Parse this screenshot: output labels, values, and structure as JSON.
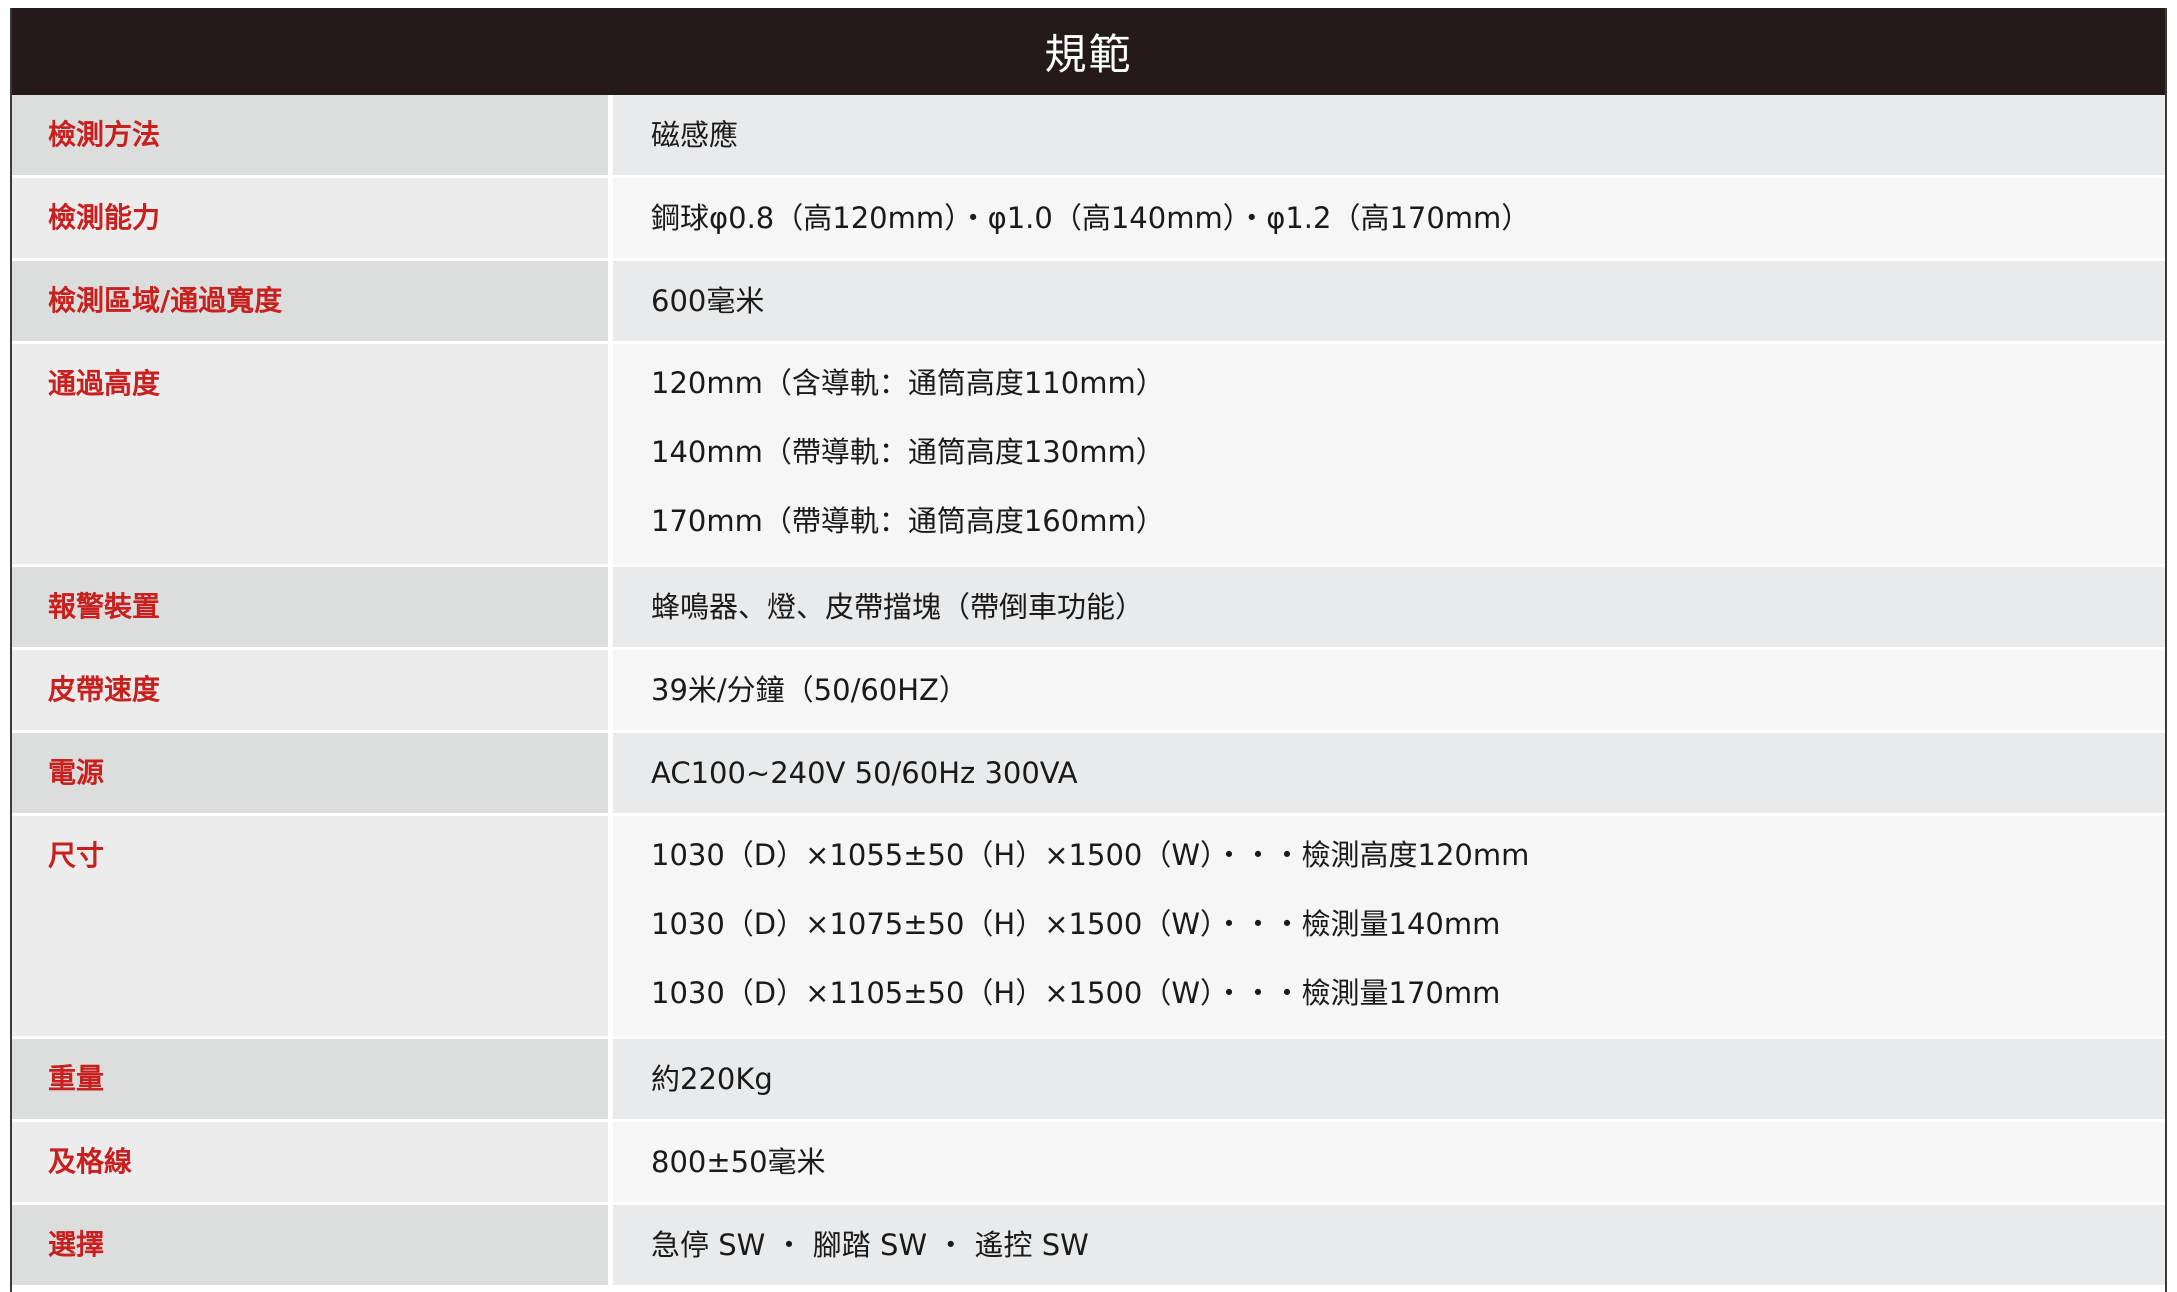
{
  "title": "規範",
  "rows": [
    {
      "label": "檢測方法",
      "values": [
        "磁感應"
      ]
    },
    {
      "label": "檢測能力",
      "values": [
        "鋼球φ0.8（高120mm）・φ1.0（高140mm）・φ1.2（高170mm）"
      ]
    },
    {
      "label": "檢測區域/通過寬度",
      "values": [
        "600毫米"
      ]
    },
    {
      "label": "通過高度",
      "values": [
        "120mm（含導軌：通筒高度110mm）",
        "140mm（帶導軌：通筒高度130mm）",
        "170mm（帶導軌：通筒高度160mm）"
      ]
    },
    {
      "label": "報警裝置",
      "values": [
        "蜂鳴器、燈、皮帶擋塊（帶倒車功能）"
      ]
    },
    {
      "label": "皮帶速度",
      "values": [
        "39米/分鐘（50/60HZ）"
      ]
    },
    {
      "label": "電源",
      "values": [
        "AC100~240V 50/60Hz 300VA"
      ]
    },
    {
      "label": "尺寸",
      "values": [
        "1030（D）×1055±50（H）×1500（W）・・・檢測高度120mm",
        "1030（D）×1075±50（H）×1500（W）・・・檢測量140mm",
        "1030（D）×1105±50（H）×1500（W）・・・檢測量170mm"
      ]
    },
    {
      "label": "重量",
      "values": [
        "約220Kg"
      ]
    },
    {
      "label": "及格線",
      "values": [
        "800±50毫米"
      ]
    },
    {
      "label": "選擇",
      "values": [
        "急停 SW ・ 腳踏 SW ・ 遙控 SW"
      ]
    }
  ],
  "colors": {
    "header_bg": "#231a19",
    "label_text": "#c8201e",
    "value_text": "#1a1a1a",
    "row_alt_label_bg": "#dcdedd",
    "row_alt_value_bg": "#e9eaeb",
    "row_plain_label_bg": "#ececec",
    "row_plain_value_bg": "#f6f6f6"
  }
}
